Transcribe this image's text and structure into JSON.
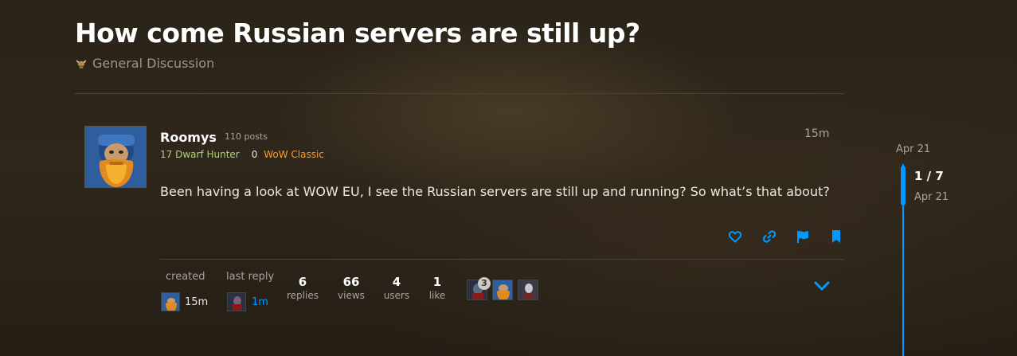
{
  "topic": {
    "title": "How come Russian servers are still up?",
    "category": "General Discussion"
  },
  "post": {
    "username": "Roomys",
    "post_count": "110 posts",
    "character": "17 Dwarf Hunter",
    "score": "0",
    "realm": "WoW Classic",
    "time": "15m",
    "body": "Been having a look at WOW EU, I see the Russian servers are still up and running? So what’s that about?",
    "actions": [
      "heart-icon",
      "link-icon",
      "flag-icon",
      "bookmark-icon"
    ]
  },
  "meta": {
    "created_label": "created",
    "created_time": "15m",
    "last_reply_label": "last reply",
    "last_reply_time": "1m",
    "stats": [
      {
        "value": "6",
        "label": "replies"
      },
      {
        "value": "66",
        "label": "views"
      },
      {
        "value": "4",
        "label": "users"
      },
      {
        "value": "1",
        "label": "like"
      }
    ],
    "participant_badge": "3"
  },
  "timeline": {
    "start_date": "Apr 21",
    "position": "1 / 7",
    "current_date": "Apr 21"
  },
  "colors": {
    "accent": "#0099ff",
    "class_hunter": "#aad372",
    "realm_classic": "#ff9a1f"
  }
}
